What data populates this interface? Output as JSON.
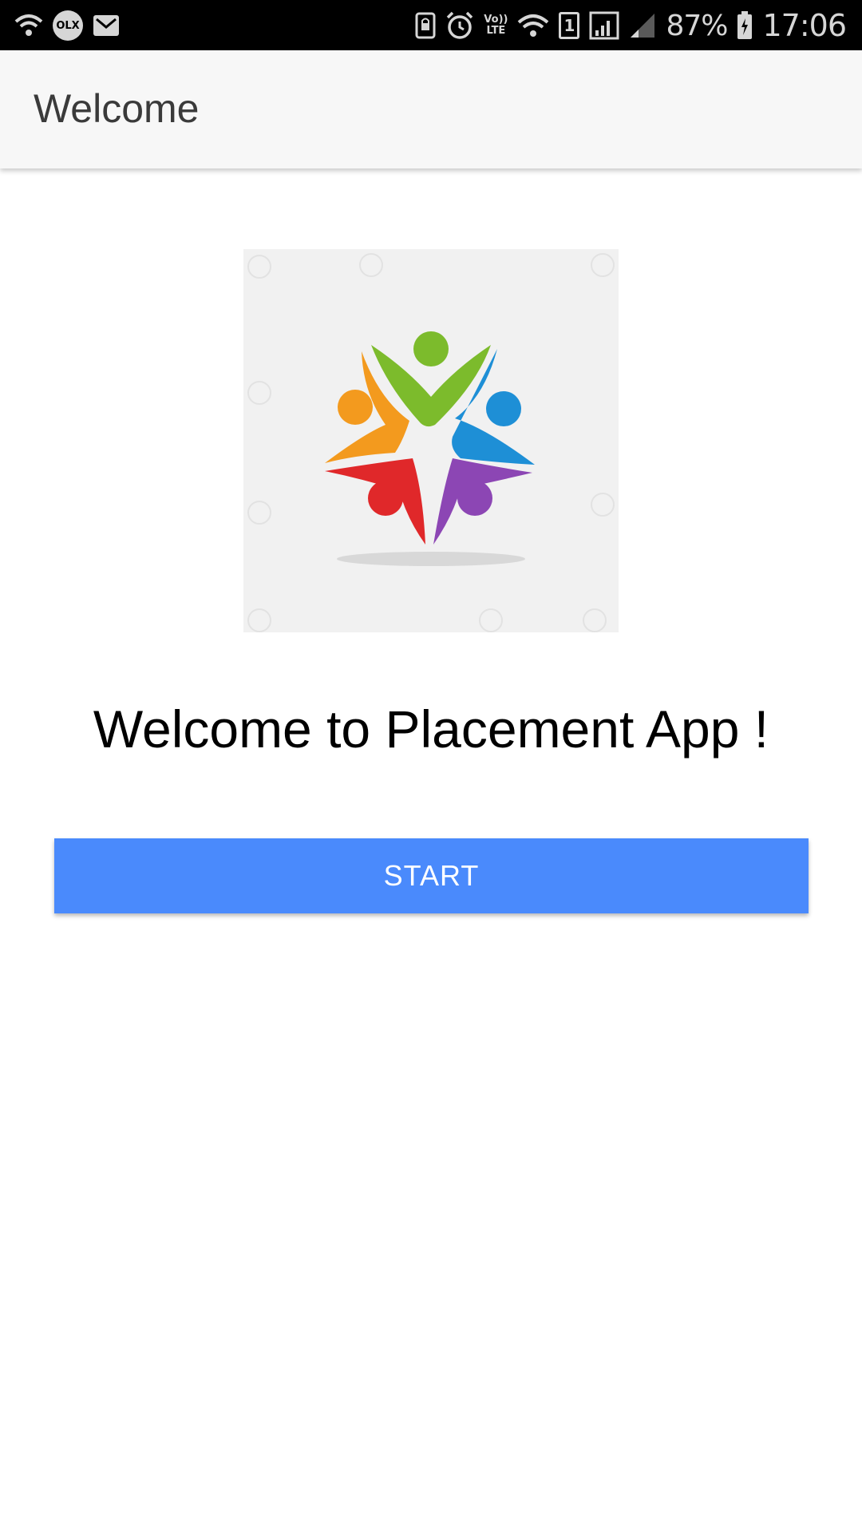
{
  "status_bar": {
    "left_icons": [
      "wifi-calling-icon",
      "olx-notification-icon",
      "gmail-notification-icon"
    ],
    "olx_label": "OLX",
    "right_icons": [
      "nfc-lock-icon",
      "alarm-icon",
      "volte-icon",
      "wifi-icon",
      "sim-icon",
      "signal-icon",
      "signal-weak-icon",
      "battery-charging-icon"
    ],
    "volte_top": "Vo))",
    "volte_bottom": "LTE",
    "sim_label": "1",
    "battery_percent": "87%",
    "time": "17:06"
  },
  "app_bar": {
    "title": "Welcome"
  },
  "main": {
    "logo": "teamwork-people-logo",
    "welcome_text": "Welcome to Placement App !",
    "start_button_label": "START"
  },
  "colors": {
    "status_bar_bg": "#000000",
    "app_bar_bg": "#f7f7f7",
    "button_bg": "#4a8afc",
    "logo_green": "#7cbb2c",
    "logo_blue": "#1e8fd6",
    "logo_orange": "#f39a1e",
    "logo_red": "#e0282a",
    "logo_purple": "#8c46b4"
  }
}
